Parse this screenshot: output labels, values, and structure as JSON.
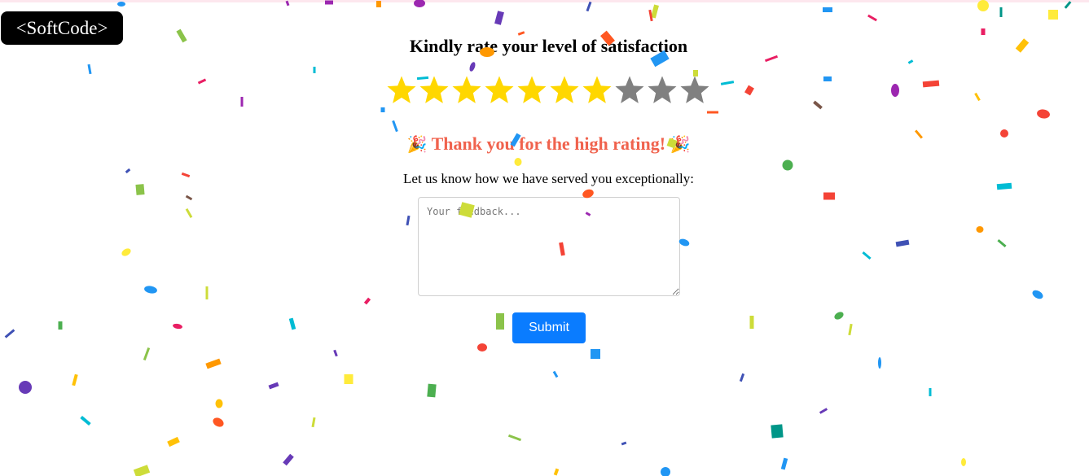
{
  "brand": {
    "logo_text": "<SoftCode>"
  },
  "rating": {
    "title": "Kindly rate your level of satisfaction",
    "max": 10,
    "value": 7,
    "filled_color": "#ffd700",
    "empty_color": "#808080"
  },
  "feedback": {
    "thanks_text": "Thank you for the high rating!",
    "party_icon": "🎉",
    "prompt": "Let us know how we have served you exceptionally:",
    "placeholder": "Your feedback...",
    "value": "",
    "submit_label": "Submit",
    "accent_color": "#f0624d",
    "button_color": "#0a7cff"
  },
  "confetti": {
    "colors": [
      "#8bc34a",
      "#ffeb3b",
      "#673ab7",
      "#ff5722",
      "#2196f3",
      "#00bcd4",
      "#f44336",
      "#e91e63",
      "#cddc39",
      "#ffc107",
      "#ff9800",
      "#4caf50",
      "#03a9f4",
      "#009688",
      "#3f51b5",
      "#9c27b0",
      "#795548"
    ]
  }
}
